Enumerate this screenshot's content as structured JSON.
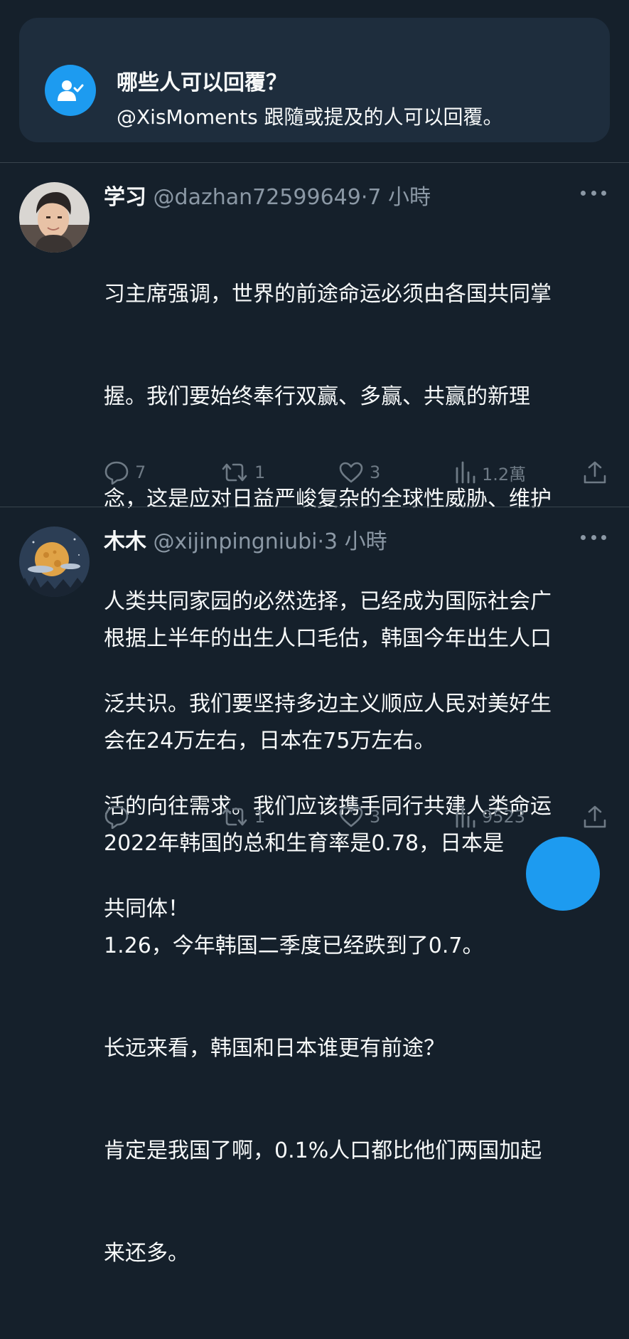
{
  "reply_notice": {
    "title": "哪些人可以回覆？",
    "description": "@XisMoments 跟隨或提及的人可以回覆。"
  },
  "tweets": [
    {
      "name": "学习",
      "handle": "@dazhan72599649",
      "separator": "·",
      "time": "7 小時",
      "text": "习主席强调，世界的前途命运必须由各国共同掌握。我们要始终奉行双赢、多赢、共赢的新理念，这是应对日益严峻复杂的全球性威胁、维护人类共同家园的必然选择，已经成为国际社会广泛共识。我们要坚持多边主义顺应人民对美好生活的向往需求。我们应该携手同行共建人类命运共同体！",
      "lines": [
        "习主席强调，世界的前途命运必须由各国共同掌",
        "握。我们要始终奉行双赢、多赢、共赢的新理",
        "念，这是应对日益严峻复杂的全球性威胁、维护",
        "人类共同家园的必然选择，已经成为国际社会广",
        "泛共识。我们要坚持多边主义顺应人民对美好生",
        "活的向往需求。我们应该携手同行共建人类命运",
        "共同体！"
      ],
      "replies": "7",
      "retweets": "1",
      "likes": "3",
      "views": "1.2萬"
    },
    {
      "name": "木木",
      "handle": "@xijinpingniubi",
      "separator": "·",
      "time": "3 小時",
      "lines": [
        "根据上半年的出生人口毛估，韩国今年出生人口",
        "会在24万左右，日本在75万左右。",
        "2022年韩国的总和生育率是0.78，日本是",
        "1.26，今年韩国二季度已经跌到了0.7。",
        "长远来看，韩国和日本谁更有前途？",
        "肯定是我国了啊，0.1%人口都比他们两国加起",
        "来还多。"
      ],
      "replies": "",
      "retweets": "1",
      "likes": "3",
      "views": "9523"
    }
  ],
  "icons": {
    "reply": "reply-icon",
    "retweet": "retweet-icon",
    "like": "heart-icon",
    "views": "views-icon",
    "share": "share-icon",
    "more": "more-icon"
  },
  "colors": {
    "background": "#15202b",
    "card": "#1e2d3d",
    "accent": "#1d9bf0",
    "muted": "#8b98a5"
  }
}
